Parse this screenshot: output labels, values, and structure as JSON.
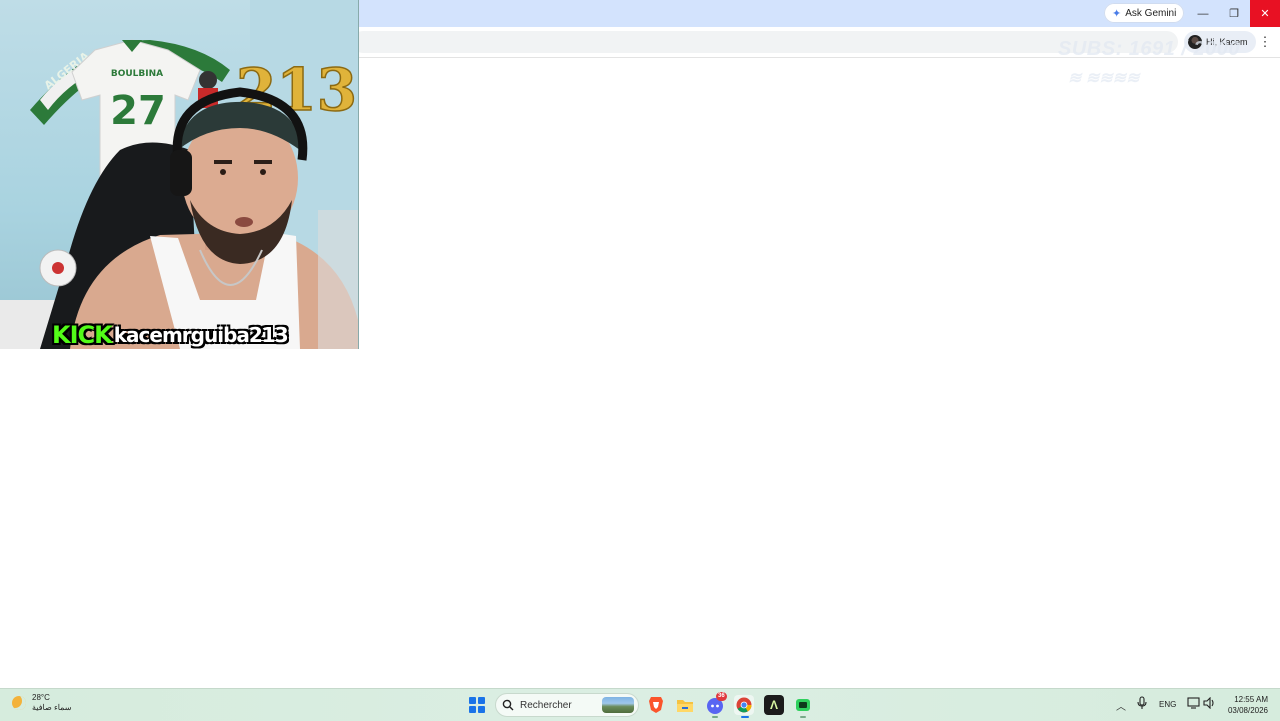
{
  "browser": {
    "ask_gemini_label": "Ask Gemini",
    "profile_greeting": "Hi, Kacem",
    "window_controls": {
      "minimize": "—",
      "maximize": "❐",
      "close": "✕"
    },
    "menu_icon": "⋮"
  },
  "stream_overlay": {
    "subs_text": "SUBS: 1691 / 2000",
    "sub_line_2": "≋ ≋≋≋≋",
    "platform": "KICK",
    "username": "kacemrguiba213",
    "jersey_name": "BOULBINA",
    "jersey_number": "27",
    "scarf_text": "ALGERIA",
    "balloon_text": "213"
  },
  "taskbar": {
    "weather": {
      "temperature": "28°C",
      "condition": "سماء صافية"
    },
    "search_placeholder": "Rechercher",
    "language": "ENG",
    "time": "12:55 AM",
    "date": "03/08/2026",
    "notification_badge": "36",
    "apps": [
      "start-icon",
      "search-icon",
      "brave-icon",
      "file-explorer-icon",
      "discord-icon",
      "chrome-icon",
      "arc-icon",
      "terminal-icon"
    ]
  },
  "colors": {
    "titlebar": "#d3e3fd",
    "close_button": "#e81123",
    "kick_green": "#53fc18",
    "taskbar": "#d6ecdd"
  }
}
